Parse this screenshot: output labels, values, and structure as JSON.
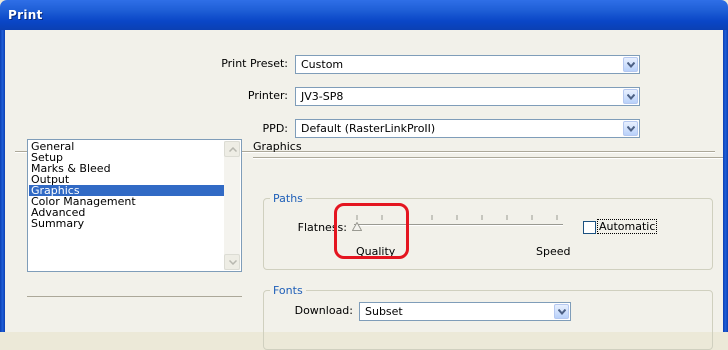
{
  "window": {
    "title": "Print"
  },
  "preset": {
    "label": "Print Preset:",
    "value": "Custom"
  },
  "printer": {
    "label": "Printer:",
    "value": "JV3-SP8"
  },
  "ppd": {
    "label": "PPD:",
    "value": "Default (RasterLinkProII)"
  },
  "sidebar": {
    "items": [
      {
        "label": "General"
      },
      {
        "label": "Setup"
      },
      {
        "label": "Marks & Bleed"
      },
      {
        "label": "Output"
      },
      {
        "label": "Graphics",
        "selected": true
      },
      {
        "label": "Color Management"
      },
      {
        "label": "Advanced"
      },
      {
        "label": "Summary"
      }
    ]
  },
  "graphics": {
    "title": "Graphics",
    "paths": {
      "group_label": "Paths",
      "flatness_label": "Flatness:",
      "quality_label": "Quality",
      "speed_label": "Speed",
      "automatic_label": "Automatic",
      "automatic_checked": false,
      "slider_value_percent": 0
    },
    "fonts": {
      "group_label": "Fonts",
      "download_label": "Download:",
      "download_value": "Subset"
    }
  },
  "colors": {
    "highlight": "#e41520",
    "selection": "#316ac5",
    "titlebar": "#0a46c7"
  },
  "icons": {
    "dropdown": "chevron-down-icon",
    "scroll_up": "arrow-up-icon",
    "scroll_down": "arrow-down-icon",
    "slider_thumb": "triangle-up-icon"
  }
}
